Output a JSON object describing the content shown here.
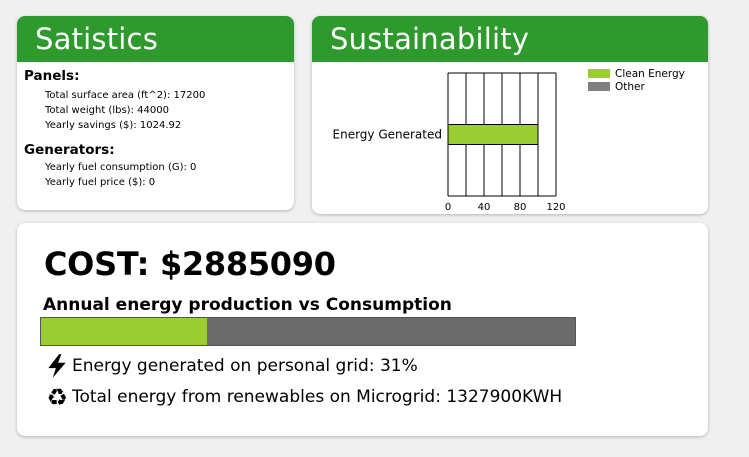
{
  "statistics": {
    "header": "Satistics",
    "panels": {
      "title": "Panels:",
      "surface_area": "Total surface area (ft^2): 17200",
      "weight": "Total weight (lbs): 44000",
      "savings": "Yearly savings ($): 1024.92"
    },
    "generators": {
      "title": "Generators:",
      "fuel_consumption": "Yearly fuel consumption (G): 0",
      "fuel_price": "Yearly fuel price ($): 0"
    }
  },
  "sustainability": {
    "header": "Sustainability",
    "chart_data": {
      "type": "bar",
      "orientation": "horizontal",
      "stacked": true,
      "categories": [
        "Energy Generated"
      ],
      "series": [
        {
          "name": "Clean Energy",
          "values": [
            100
          ],
          "color": "#9acd32"
        },
        {
          "name": "Other",
          "values": [
            0
          ],
          "color": "#808080"
        }
      ],
      "xlim": [
        0,
        120
      ],
      "xticks_top_row": [
        "0",
        "40",
        "80",
        "120"
      ],
      "xticks_bottom_row": [
        "20",
        "60",
        "100"
      ],
      "grid": true,
      "legend_position": "top-right"
    }
  },
  "cost": {
    "title": "COST: $2885090",
    "progress_title": "Annual energy production vs Consumption",
    "progress_fraction": 0.31,
    "colors": {
      "fill": "#9acd32",
      "track": "#6b6b6b"
    },
    "grid_text": "Energy generated on personal grid: 31%",
    "microgrid_text": "Total energy from renewables on Microgrid: 1327900KWH",
    "icons": {
      "grid": "lightning-bolt-icon",
      "microgrid": "recycle-icon"
    }
  }
}
